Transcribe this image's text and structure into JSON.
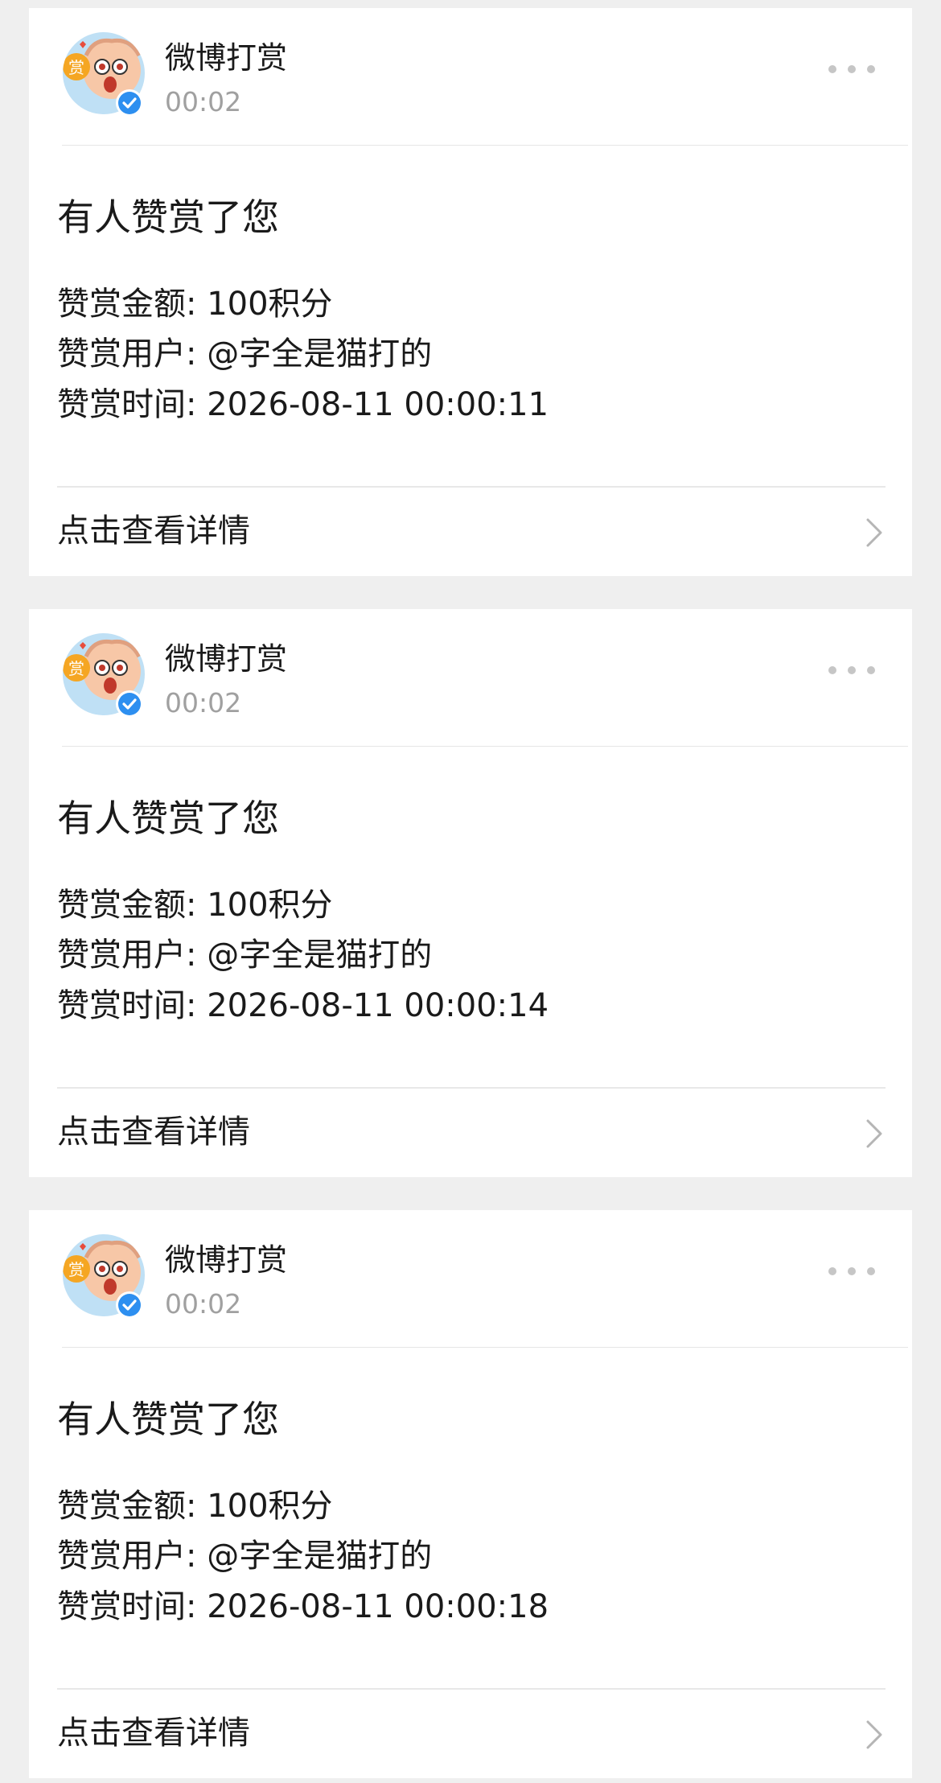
{
  "colors": {
    "background": "#efefef",
    "card": "#ffffff",
    "text_primary": "#1a1a1a",
    "text_secondary": "#a0a0a0",
    "verified_badge": "#2d8ff0",
    "reward_badge": "#f5a623"
  },
  "icons": {
    "avatar": "reward-mascot-avatar",
    "verified": "verified-badge-icon",
    "more": "more-dots-icon",
    "chevron": "chevron-right-icon"
  },
  "messages": [
    {
      "sender": "微博打赏",
      "time": "00:02",
      "title": "有人赞赏了您",
      "amount_line": "赞赏金额: 100积分",
      "user_line": "赞赏用户: @字全是猫打的",
      "time_line": "赞赏时间: 2026-08-11 00:00:11",
      "link_label": "点击查看详情"
    },
    {
      "sender": "微博打赏",
      "time": "00:02",
      "title": "有人赞赏了您",
      "amount_line": "赞赏金额: 100积分",
      "user_line": "赞赏用户: @字全是猫打的",
      "time_line": "赞赏时间: 2026-08-11 00:00:14",
      "link_label": "点击查看详情"
    },
    {
      "sender": "微博打赏",
      "time": "00:02",
      "title": "有人赞赏了您",
      "amount_line": "赞赏金额: 100积分",
      "user_line": "赞赏用户: @字全是猫打的",
      "time_line": "赞赏时间: 2026-08-11 00:00:18",
      "link_label": "点击查看详情"
    }
  ]
}
